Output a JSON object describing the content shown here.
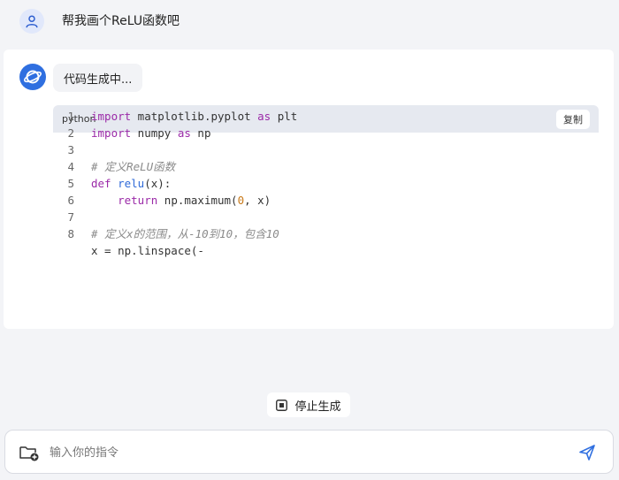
{
  "user_message": {
    "text": "帮我画个ReLU函数吧"
  },
  "assistant": {
    "status": "代码生成中...",
    "code_block": {
      "language": "python",
      "copy_label": "复制",
      "lines": [
        {
          "num": "1",
          "tokens": [
            {
              "t": "kw",
              "v": "import"
            },
            {
              "t": "",
              "v": " matplotlib.pyplot "
            },
            {
              "t": "kw",
              "v": "as"
            },
            {
              "t": "",
              "v": " plt"
            }
          ]
        },
        {
          "num": "2",
          "tokens": [
            {
              "t": "kw",
              "v": "import"
            },
            {
              "t": "",
              "v": " numpy "
            },
            {
              "t": "kw",
              "v": "as"
            },
            {
              "t": "",
              "v": " np"
            }
          ]
        },
        {
          "num": "3",
          "tokens": []
        },
        {
          "num": "4",
          "tokens": [
            {
              "t": "cm",
              "v": "# 定义ReLU函数"
            }
          ]
        },
        {
          "num": "5",
          "tokens": [
            {
              "t": "kw",
              "v": "def"
            },
            {
              "t": "",
              "v": " "
            },
            {
              "t": "fn",
              "v": "relu"
            },
            {
              "t": "",
              "v": "(x):"
            }
          ]
        },
        {
          "num": "6",
          "tokens": [
            {
              "t": "",
              "v": "    "
            },
            {
              "t": "kw",
              "v": "return"
            },
            {
              "t": "",
              "v": " np.maximum("
            },
            {
              "t": "num",
              "v": "0"
            },
            {
              "t": "",
              "v": ", x)"
            }
          ]
        },
        {
          "num": "7",
          "tokens": []
        },
        {
          "num": "8",
          "tokens": [
            {
              "t": "cm",
              "v": "# 定义x的范围，从-10到10，包含10"
            }
          ]
        },
        {
          "num": "",
          "tokens": [
            {
              "t": "",
              "v": "x = np.linspace(-"
            }
          ]
        }
      ]
    }
  },
  "controls": {
    "stop_label": "停止生成",
    "input_placeholder": "输入你的指令",
    "accent_color": "#2f6fe0"
  }
}
